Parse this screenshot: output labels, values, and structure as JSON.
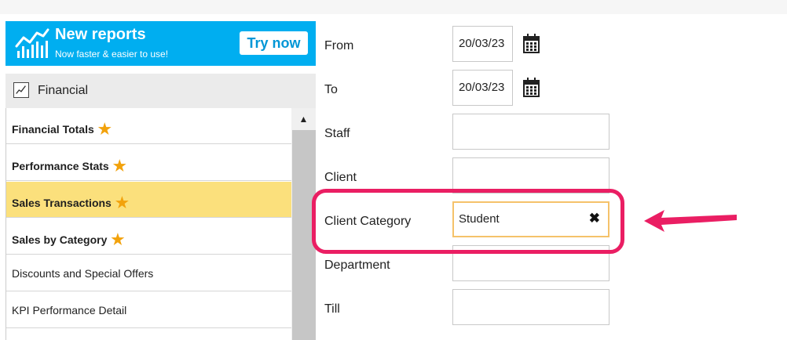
{
  "banner": {
    "title": "New reports",
    "subtitle": "Now faster & easier to use!",
    "try_button": "Try now",
    "icon": "chart-trend-icon"
  },
  "category": {
    "label": "Financial",
    "icon": "line-chart-icon"
  },
  "reports": [
    {
      "label": "Financial Totals",
      "bold": true,
      "starred": true,
      "selected": false
    },
    {
      "label": "Performance Stats",
      "bold": true,
      "starred": true,
      "selected": false
    },
    {
      "label": "Sales Transactions",
      "bold": true,
      "starred": true,
      "selected": true
    },
    {
      "label": "Sales by Category",
      "bold": true,
      "starred": true,
      "selected": false
    },
    {
      "label": "Discounts and Special Offers",
      "bold": false,
      "starred": false,
      "selected": false
    },
    {
      "label": "KPI Performance Detail",
      "bold": false,
      "starred": false,
      "selected": false
    }
  ],
  "scrollbar": {
    "up_arrow": "▲"
  },
  "form": {
    "from_label": "From",
    "from_value": "20/03/23",
    "to_label": "To",
    "to_value": "20/03/23",
    "staff_label": "Staff",
    "staff_value": "",
    "client_label": "Client",
    "client_value": "",
    "client_category_label": "Client Category",
    "client_category_value": "Student",
    "clear_symbol": "✖",
    "department_label": "Department",
    "department_value": "",
    "till_label": "Till",
    "till_value": ""
  },
  "colors": {
    "banner": "#00aef0",
    "selected_row": "#fbe07c",
    "star": "#f2a20c",
    "annotation": "#ea1e63",
    "active_border": "#f5c26a"
  }
}
